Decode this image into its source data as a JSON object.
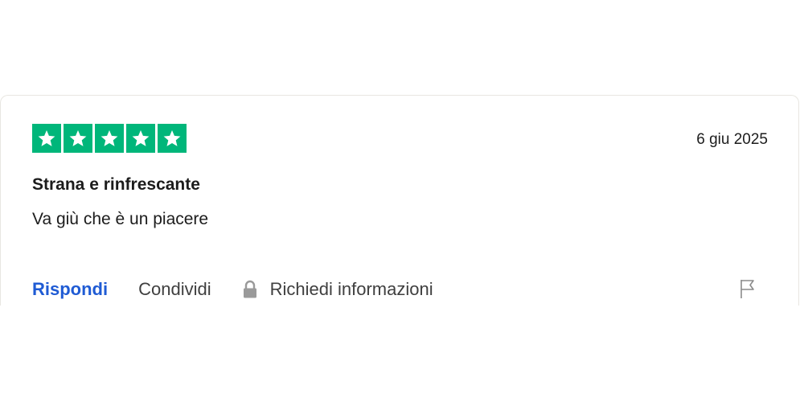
{
  "review": {
    "rating": 5,
    "rating_max": 5,
    "date": "6 giu 2025",
    "title": "Strana e rinfrescante",
    "body": "Va giù che è un piacere"
  },
  "actions": {
    "reply_label": "Rispondi",
    "share_label": "Condividi",
    "request_info_label": "Richiedi informazioni"
  },
  "icons": {
    "star": "star-icon",
    "lock": "lock-icon",
    "flag": "flag-icon"
  },
  "colors": {
    "star_background": "#00b67a",
    "reply_link": "#1f5bd4",
    "text": "#1c1c1c"
  }
}
